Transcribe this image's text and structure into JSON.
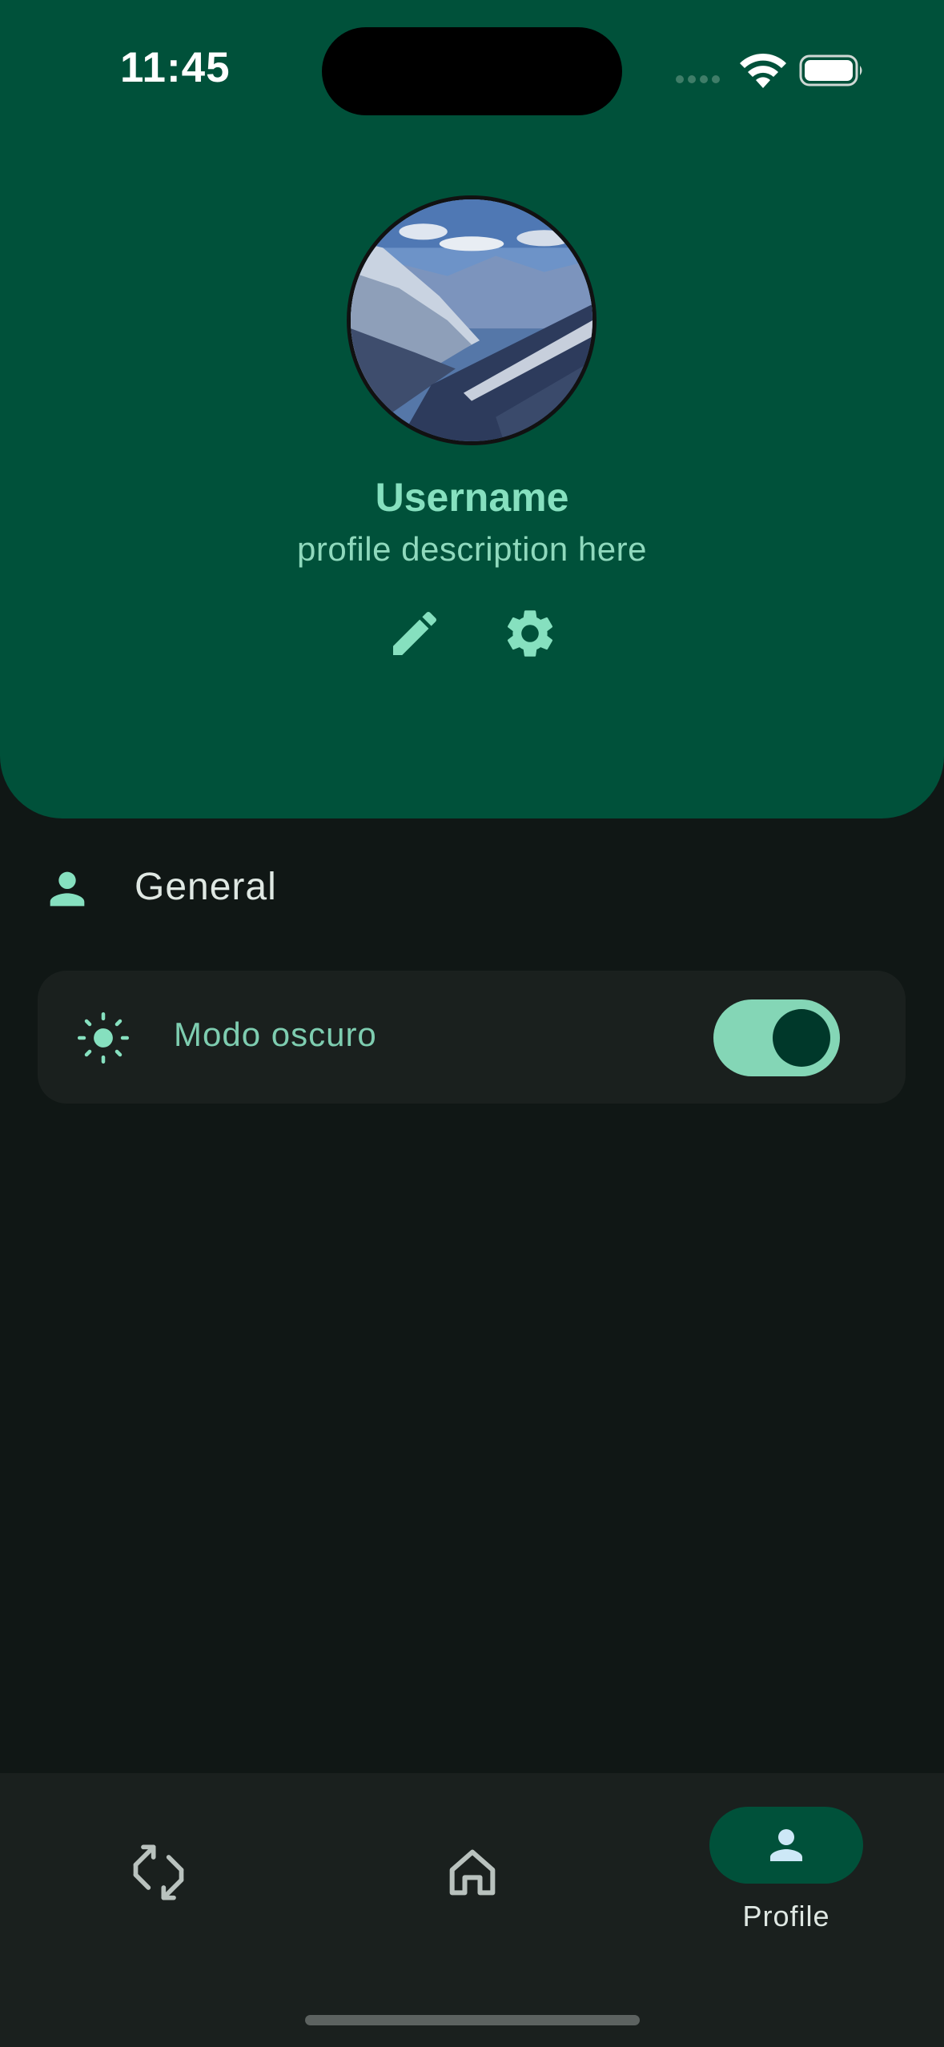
{
  "status_bar": {
    "time": "11:45"
  },
  "profile": {
    "username": "Username",
    "description": "profile description here"
  },
  "section": {
    "label": "General",
    "icon": "person-icon"
  },
  "settings": [
    {
      "label": "Modo oscuro",
      "icon": "sun-icon",
      "enabled": true
    }
  ],
  "nav": {
    "items": [
      {
        "icon": "swap-icon",
        "label": ""
      },
      {
        "icon": "home-icon",
        "label": ""
      },
      {
        "icon": "person-icon",
        "label": "Profile",
        "selected": true
      }
    ]
  },
  "colors": {
    "header": "#00513a",
    "background": "#101715",
    "accent": "#86e0bf",
    "card": "#1a201e"
  }
}
